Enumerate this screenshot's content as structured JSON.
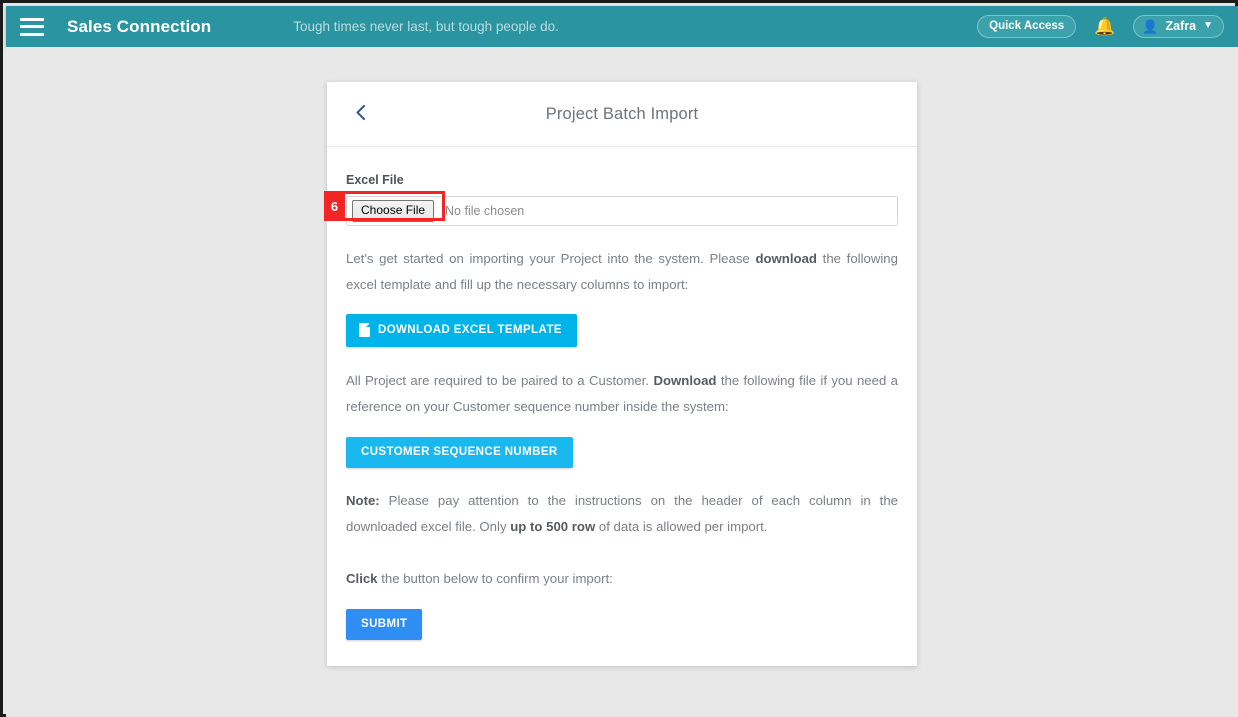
{
  "topbar": {
    "menu_icon": "hamburger-icon",
    "brand": "Sales Connection",
    "tagline": "Tough times never last, but tough people do.",
    "quick_access_label": "Quick Access",
    "bell_icon": "bell-icon",
    "user_icon": "user-avatar-icon",
    "user_name": "Zafra",
    "caret_icon": "chevron-down-icon",
    "bg_color": "#2a95a0"
  },
  "card": {
    "back_icon": "chevron-left-icon",
    "title": "Project Batch Import"
  },
  "form": {
    "excel_file_label": "Excel File",
    "choose_file_button": "Choose File",
    "no_file_text": "No file chosen",
    "annotation_number": "6",
    "annotation_color": "#f22424"
  },
  "instructions": {
    "para1_a": "Let's get started on importing your Project into the system. Please ",
    "para1_b": "download",
    "para1_c": " the following excel template and fill up the necessary columns to import:",
    "download_template_button": "DOWNLOAD EXCEL TEMPLATE",
    "download_template_icon": "file-icon",
    "download_template_color": "#00b3e8",
    "para2_a": "All Project are required to be paired to a Customer. ",
    "para2_b": "Download",
    "para2_c": " the following file if you need a reference on your Customer sequence number inside the system:",
    "customer_sequence_button": "CUSTOMER SEQUENCE NUMBER",
    "customer_sequence_color": "#19b9ef",
    "para3_a": "Note:",
    "para3_b": " Please pay attention to the instructions on the header of each column in the downloaded excel file. Only ",
    "para3_c": "up to 500 row",
    "para3_d": " of data is allowed per import.",
    "para4_a": "Click",
    "para4_b": " the button below to confirm your import:",
    "submit_button": "SUBMIT",
    "submit_color": "#2f8ef4"
  }
}
